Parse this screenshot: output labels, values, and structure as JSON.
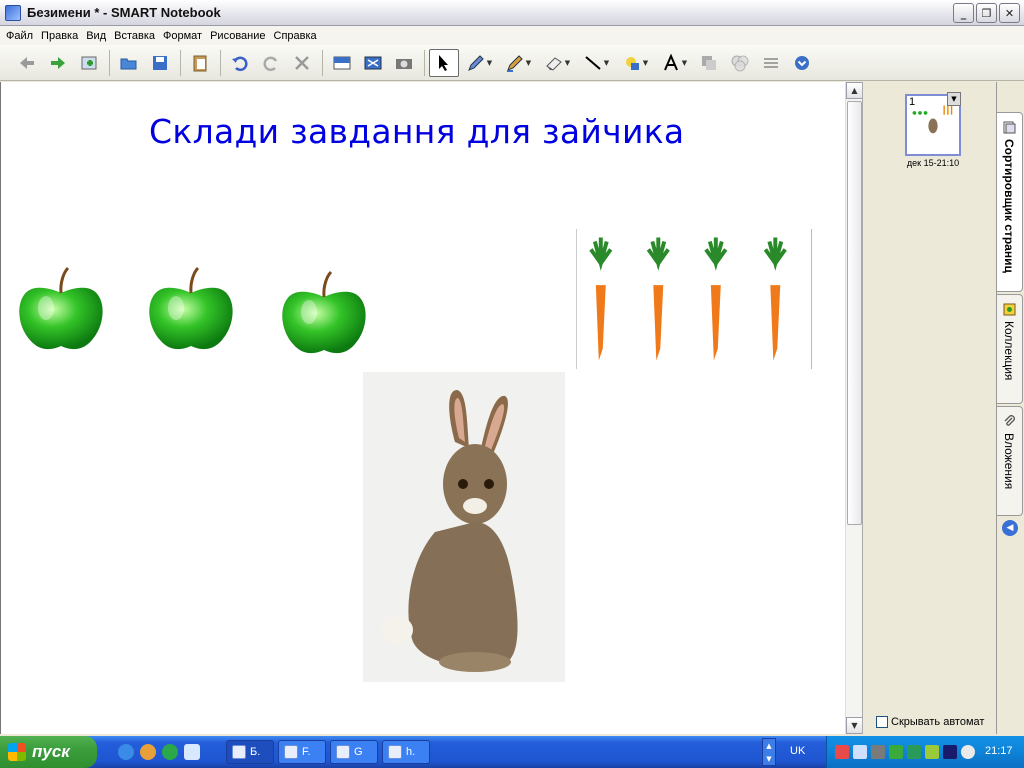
{
  "window": {
    "title": "Безимени * - SMART Notebook"
  },
  "menu": [
    "Файл",
    "Правка",
    "Вид",
    "Вставка",
    "Формат",
    "Рисование",
    "Справка"
  ],
  "slide": {
    "title": "Склади завдання для зайчика"
  },
  "sidepanel": {
    "page_number": "1",
    "thumbnail_label": "дек 15-21:10",
    "autohide_label": "Скрывать автомат"
  },
  "tabs": [
    {
      "label": "Сортировщик страниц",
      "active": true
    },
    {
      "label": "Коллекция",
      "active": false
    },
    {
      "label": "Вложения",
      "active": false
    }
  ],
  "taskbar": {
    "start_label": "пуск",
    "tasks": [
      "Б.",
      "F.",
      "G",
      "h."
    ],
    "language": "UK",
    "clock": "21:17"
  }
}
